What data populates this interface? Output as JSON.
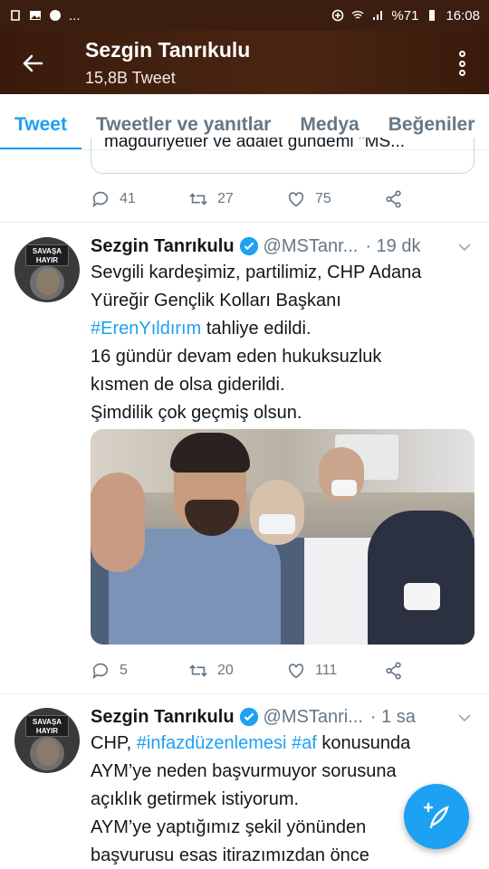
{
  "status_bar": {
    "battery": "%71",
    "time": "16:08",
    "dots": "..."
  },
  "header": {
    "title": "Sezgin Tanrıkulu",
    "subtitle": "15,8B Tweet"
  },
  "tabs": [
    {
      "label": "Tweet",
      "active": true
    },
    {
      "label": "Tweetler ve yanıtlar",
      "active": false
    },
    {
      "label": "Medya",
      "active": false
    },
    {
      "label": "Beğeniler",
      "active": false
    }
  ],
  "prev_tweet": {
    "quote_snippet": "mağduriyetler ve adalet gündemi \"MS...",
    "replies": "41",
    "retweets": "27",
    "likes": "75"
  },
  "tweet1": {
    "name": "Sezgin Tanrıkulu",
    "handle": "@MSTanr...",
    "time": "· 19 dk",
    "avatar_sign": "SAVAŞA HAYIR",
    "lines": [
      "Sevgili kardeşimiz, partilimiz, CHP Adana",
      "Yüreğir Gençlik Kolları Başkanı"
    ],
    "hashtag": "#ErenYıldırım",
    "hashtag_tail": " tahliye edildi.",
    "lines2": [
      "16 gündür devam eden hukuksuzluk",
      "kısmen de olsa giderildi.",
      "Şimdilik çok geçmiş olsun."
    ],
    "replies": "5",
    "retweets": "20",
    "likes": "111"
  },
  "tweet2": {
    "name": "Sezgin Tanrıkulu",
    "handle": "@MSTanri...",
    "time": "· 1 sa",
    "avatar_sign": "SAVAŞA HAYIR",
    "line1_pre": "CHP, ",
    "hashtag1": "#infazdüzenlemesi",
    "hashtag2": "#af",
    "line1_post": " konusunda",
    "lines": [
      "AYM’ye neden başvurmuyor sorusuna",
      "açıklık getirmek istiyorum.",
      "AYM’ye yaptığımız şekil yönünden",
      "başvurusu esas itirazımızdan önce"
    ]
  },
  "colors": {
    "accent": "#1da1f2",
    "header_bg": "#3c1e10",
    "muted": "#657786"
  },
  "icons": [
    "back-arrow-icon",
    "more-vertical-icon",
    "reply-icon",
    "retweet-icon",
    "like-icon",
    "share-icon",
    "verified-icon",
    "caret-down-icon",
    "compose-icon"
  ]
}
